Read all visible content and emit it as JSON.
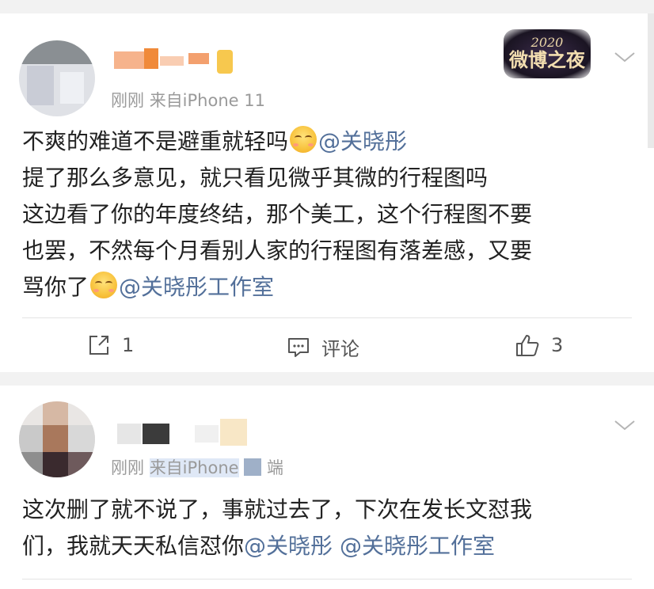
{
  "posts": [
    {
      "meta_time": "刚刚",
      "meta_source": "来自iPhone 11",
      "badge": {
        "year": "2020",
        "title": "微博之夜"
      },
      "lines": [
        [
          {
            "t": "text",
            "v": "不爽的难道不是避重就轻吗"
          },
          {
            "t": "emoji",
            "v": "smiling-emoji"
          },
          {
            "t": "mention",
            "v": "@关晓彤"
          }
        ],
        [
          {
            "t": "text",
            "v": "提了那么多意见，就只看见微乎其微的行程图吗"
          }
        ],
        [
          {
            "t": "text",
            "v": "这边看了你的年度终结，那个美工，这个行程图不要"
          }
        ],
        [
          {
            "t": "text",
            "v": "也罢，不然每个月看别人家的行程图有落差感，又要"
          }
        ],
        [
          {
            "t": "text",
            "v": "骂你了"
          },
          {
            "t": "emoji",
            "v": "smiling-emoji"
          },
          {
            "t": "mention",
            "v": "@关晓彤工作室"
          }
        ]
      ],
      "actions": {
        "repost": "1",
        "comment": "评论",
        "like": "3"
      }
    },
    {
      "meta_time": "刚刚",
      "meta_source": "来自iPhone",
      "meta_source_tail": "端",
      "lines": [
        [
          {
            "t": "text",
            "v": "这次删了就不说了，事就过去了，下次在发长文怼我"
          }
        ],
        [
          {
            "t": "text",
            "v": "们，我就天天私信怼你"
          },
          {
            "t": "mention",
            "v": "@关晓彤"
          },
          {
            "t": "text",
            "v": " "
          },
          {
            "t": "mention",
            "v": "@关晓彤工作室"
          }
        ]
      ]
    }
  ],
  "colors": {
    "mention": "#53709a",
    "meta": "#9a9a9a",
    "text": "#222222",
    "background": "#f2f2f2"
  }
}
